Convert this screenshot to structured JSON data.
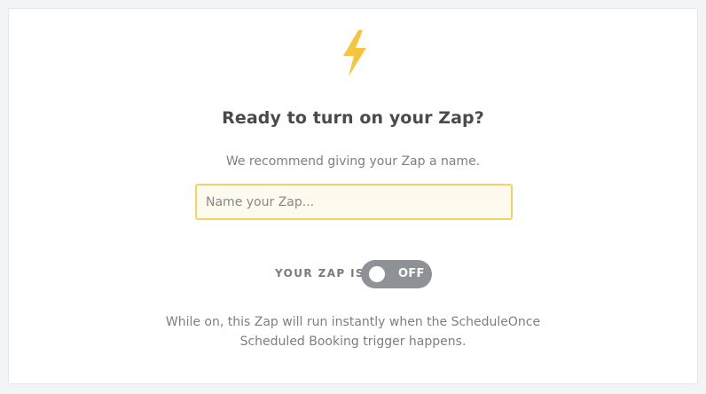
{
  "dialog": {
    "title": "Ready to turn on your Zap?",
    "subtitle": "We recommend giving your Zap a name.",
    "name_input": {
      "value": "",
      "placeholder": "Name your Zap..."
    },
    "status": {
      "label": "YOUR ZAP IS",
      "toggle_state": "OFF"
    },
    "description_line1": "While on, this Zap will run instantly when the ScheduleOnce",
    "description_line2": "Scheduled Booking trigger happens.",
    "icon": "lightning-bolt-icon"
  },
  "colors": {
    "accent_yellow": "#f6c342",
    "input_border": "#f2d16b",
    "input_background": "#fffaee",
    "toggle_off": "#8e9196"
  }
}
